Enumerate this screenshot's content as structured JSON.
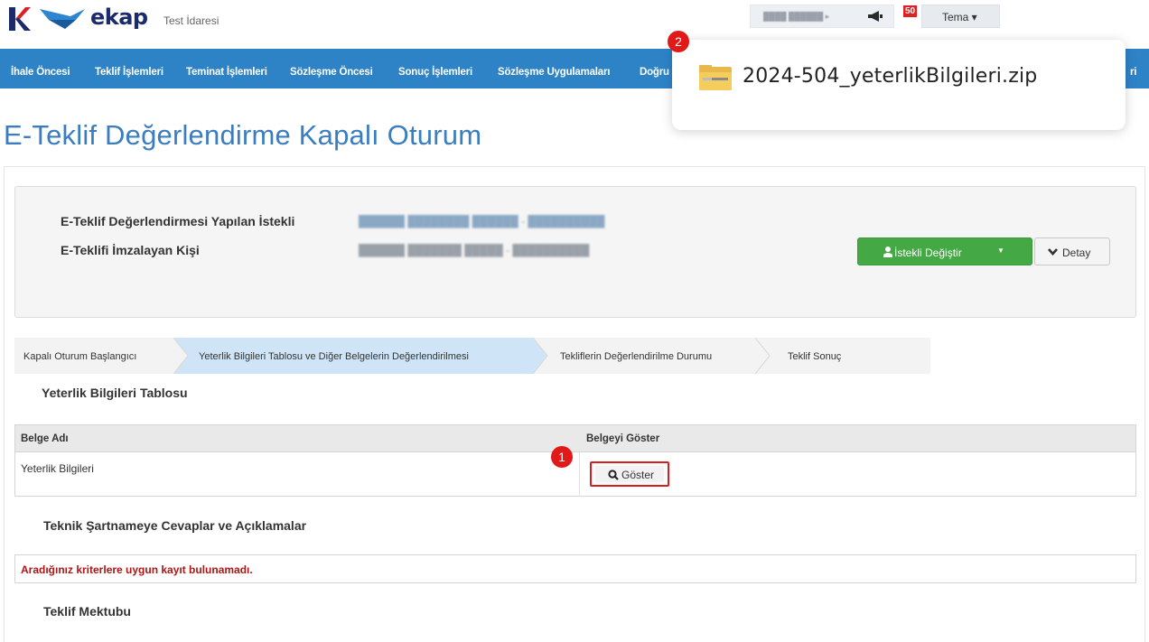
{
  "header": {
    "brand": "ekap",
    "org": "Test İdaresi",
    "notification_count": "50",
    "theme_label": "Tema ▾"
  },
  "nav": {
    "items": [
      "İhale Öncesi",
      "Teklif İşlemleri",
      "Teminat İşlemleri",
      "Sözleşme Öncesi",
      "Sonuç İşlemleri",
      "Sözleşme Uygulamaları",
      "Doğru"
    ],
    "tail": "ri"
  },
  "page": {
    "title": "E-Teklif Değerlendirme Kapalı Oturum"
  },
  "info": {
    "label1": "E-Teklif Değerlendirmesi Yapılan İstekli",
    "label2": "E-Teklifi İmzalayan Kişi",
    "istekli_button": "İstekli Değiştir",
    "detay_button": "Detay"
  },
  "steps": [
    "Kapalı Oturum Başlangıcı",
    "Yeterlik Bilgileri Tablosu ve Diğer Belgelerin Değerlendirilmesi",
    "Tekliflerin Değerlendirilme Durumu",
    "Teklif Sonuç"
  ],
  "sections": {
    "yeterlik_title": "Yeterlik Bilgileri Tablosu",
    "teknik_title": "Teknik Şartnameye Cevaplar ve Açıklamalar",
    "mektup_title": "Teklif Mektubu"
  },
  "table": {
    "col1": "Belge Adı",
    "col2": "Belgeyi Göster",
    "row1_name": "Yeterlik Bilgileri",
    "show_button": "Göster"
  },
  "alert": {
    "text": "Aradığınız kriterlere uygun kayıt bulunamadı."
  },
  "markers": {
    "m1": "1",
    "m2": "2"
  },
  "download": {
    "filename": "2024-504_yeterlikBilgileri.zip"
  },
  "colors": {
    "nav": "#2e83c7",
    "title": "#3a7ec0",
    "green": "#44a844",
    "active_step": "#cfe5f7",
    "marker": "#e11919"
  }
}
